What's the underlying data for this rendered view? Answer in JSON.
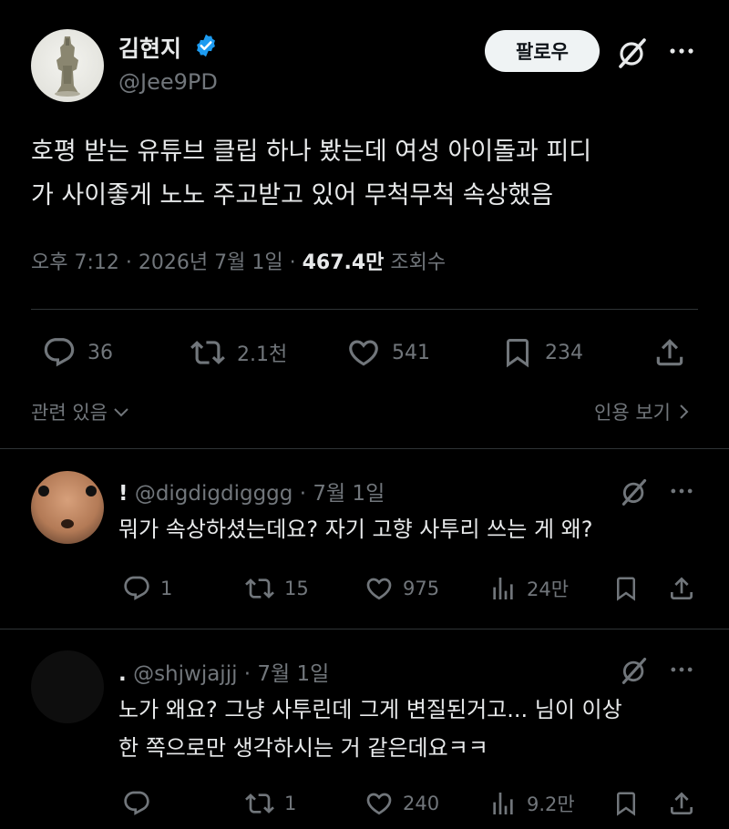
{
  "tweet": {
    "author_name": "김현지",
    "author_handle": "@Jee9PD",
    "follow_label": "팔로우",
    "text_line1": "호평 받는 유튜브 클립 하나 봤는데 여성 아이돌과 피디",
    "text_line2": "가 사이좋게 노노 주고받고 있어 무척무척 속상했음",
    "time": "오후 7:12",
    "date": "2026년 7월 1일",
    "views_count": "467.4만",
    "views_label": "조회수",
    "replies": "36",
    "retweets": "2.1천",
    "likes": "541",
    "bookmarks": "234",
    "related_label": "관련 있음",
    "quotes_label": "인용 보기"
  },
  "replies": [
    {
      "display_name": "!",
      "handle": "@digdigdigggg",
      "date": "7월 1일",
      "text_lines": [
        "뭐가 속상하셨는데요? 자기 고향 사투리 쓰는 게 왜?"
      ],
      "replies": "1",
      "retweets": "15",
      "likes": "975",
      "views": "24만"
    },
    {
      "display_name": ".",
      "handle": "@shjwjajjj",
      "date": "7월 1일",
      "text_lines": [
        "노가 왜요? 그냥 사투린데 그게 변질된거고... 님이 이상",
        "한 쪽으로만 생각하시는 거 같은데요ㅋㅋ"
      ],
      "replies": "",
      "retweets": "1",
      "likes": "240",
      "views": "9.2만"
    }
  ],
  "colors": {
    "background": "#000000",
    "text": "#e7e9ea",
    "secondary": "#71767b",
    "divider": "#2f3336",
    "verified": "#1d9bf0"
  },
  "icons": [
    "verified-icon",
    "grok-icon",
    "more-icon",
    "reply-icon",
    "retweet-icon",
    "like-icon",
    "bookmark-icon",
    "share-icon",
    "views-icon",
    "chevron-down-icon",
    "chevron-right-icon"
  ]
}
